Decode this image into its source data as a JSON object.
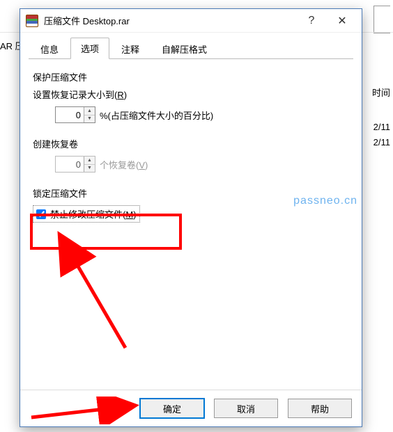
{
  "background": {
    "left_fragment": "AR 压",
    "col_header": "时间",
    "row1": "2/11",
    "row2": "2/11"
  },
  "dialog": {
    "title": "压缩文件 Desktop.rar",
    "help_glyph": "?",
    "close_glyph": "✕",
    "tabs": {
      "info": "信息",
      "options": "选项",
      "comment": "注释",
      "sfx": "自解压格式"
    },
    "panel": {
      "protect": {
        "group": "保护压缩文件",
        "label_pre": "设置恢复记录大小到(",
        "label_key": "R",
        "label_post": ")",
        "value": "0",
        "suffix": "%(占压缩文件大小的百分比)"
      },
      "recovery": {
        "group": "创建恢复卷",
        "value": "0",
        "suffix_pre": "个恢复卷(",
        "suffix_key": "V",
        "suffix_post": ")"
      },
      "lock": {
        "group": "锁定压缩文件",
        "checked": true,
        "label_pre": "禁止修改压缩文件(",
        "label_key": "M",
        "label_post": ")"
      }
    },
    "watermark": "passneo.cn",
    "buttons": {
      "ok": "确定",
      "cancel": "取消",
      "help": "帮助"
    }
  }
}
